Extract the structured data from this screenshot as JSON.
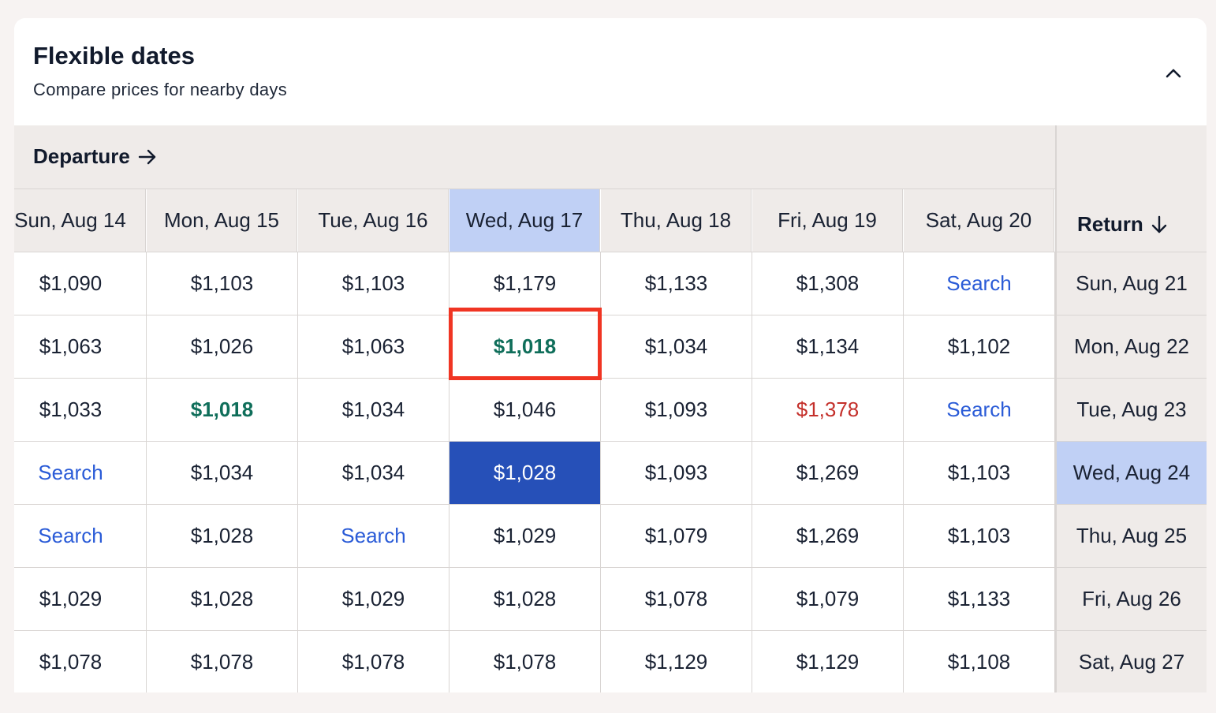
{
  "header": {
    "title": "Flexible dates",
    "subtitle": "Compare prices for nearby days",
    "collapse_icon": "chevron-up-icon"
  },
  "departure_label": "Departure",
  "return_label": "Return",
  "departure_dates": [
    "Sun, Aug 14",
    "Mon, Aug 15",
    "Tue, Aug 16",
    "Wed, Aug 17",
    "Thu, Aug 18",
    "Fri, Aug 19",
    "Sat, Aug 20"
  ],
  "return_dates": [
    "Sun, Aug 21",
    "Mon, Aug 22",
    "Tue, Aug 23",
    "Wed, Aug 24",
    "Thu, Aug 25",
    "Fri, Aug 26",
    "Sat, Aug 27"
  ],
  "selected_departure": "Wed, Aug 17",
  "selected_return": "Wed, Aug 24",
  "grid": [
    [
      "$1,090",
      "$1,103",
      "$1,103",
      "$1,179",
      "$1,133",
      "$1,308",
      "Search"
    ],
    [
      "$1,063",
      "$1,026",
      "$1,063",
      "$1,018",
      "$1,034",
      "$1,134",
      "$1,102"
    ],
    [
      "$1,033",
      "$1,018",
      "$1,034",
      "$1,046",
      "$1,093",
      "$1,378",
      "Search"
    ],
    [
      "Search",
      "$1,034",
      "$1,034",
      "$1,028",
      "$1,093",
      "$1,269",
      "$1,103"
    ],
    [
      "Search",
      "$1,028",
      "Search",
      "$1,029",
      "$1,079",
      "$1,269",
      "$1,103"
    ],
    [
      "$1,029",
      "$1,028",
      "$1,029",
      "$1,028",
      "$1,078",
      "$1,079",
      "$1,133"
    ],
    [
      "$1,078",
      "$1,078",
      "$1,078",
      "$1,078",
      "$1,129",
      "$1,129",
      "$1,108"
    ]
  ],
  "colors": {
    "cheapest": "#0f6e5a",
    "most_expensive": "#c4302b",
    "search_link": "#2a5bd7",
    "selected_cell": "#2650b8",
    "selected_header": "#c0d0f5",
    "annotation_box": "#f03523"
  }
}
